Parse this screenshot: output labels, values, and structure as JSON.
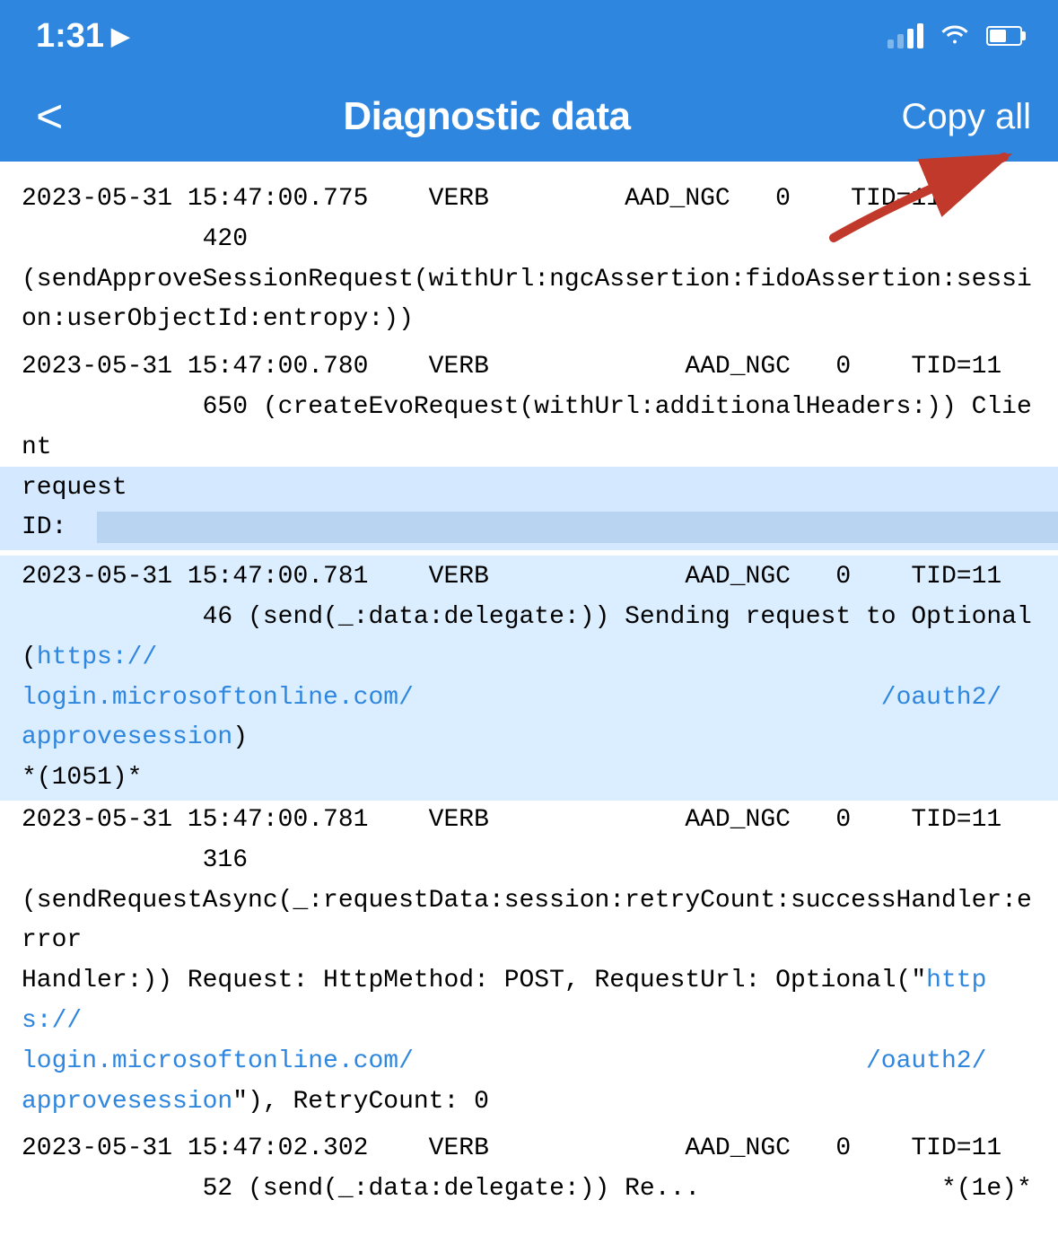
{
  "statusBar": {
    "time": "1:31",
    "timeArrow": "➤"
  },
  "navBar": {
    "backLabel": "<",
    "title": "Diagnostic data",
    "copyAllLabel": "Copy all"
  },
  "logEntries": [
    {
      "id": "entry1",
      "header": "2023-05-31 15:47:00.775    VERB         AAD_NGC    0    TID=11",
      "body": "            420\n(sendApproveSessionRequest(withUrl:ngcAssertion:fidoAssertion:session:userObjectId:entropy:))",
      "hasRequestId": false,
      "hasHighlight": false
    },
    {
      "id": "entry2",
      "header": "2023-05-31 15:47:00.780    VERB              AAD_NGC    0    TID=11",
      "body": "            650 (createEvoRequest(withUrl:additionalHeaders:)) Client\nrequest ID:",
      "hasRequestId": true,
      "hasHighlight": false
    },
    {
      "id": "entry3",
      "header": "2023-05-31 15:47:00.781    VERB              AAD_NGC    0    TID=11",
      "bodyStart": "            46 (send(_:data:delegate:)) Sending request to Optional(",
      "link1": "https://login.microsoftonline.com/",
      "link2": "/oauth2/approvesession",
      "bodyEnd": ")\n*(1051)*",
      "hasHighlight": true
    },
    {
      "id": "entry4",
      "header": "2023-05-31 15:47:00.781    VERB              AAD_NGC    0    TID=11",
      "bodyStart": "            316\n(sendRequestAsync(_:requestData:session:retryCount:successHandler:errorHandler:)) Request: HttpMethod: POST, RequestUrl: Optional(\"",
      "link1": "https://login.microsoftonline.com/",
      "link2": "/oauth2/approvesession",
      "bodyEnd": "\"), RetryCount: 0",
      "hasHighlight": false
    },
    {
      "id": "entry5",
      "header": "2023-05-31 15:47:02.302    VERB              AAD_NGC    0    TID=11",
      "bodyStart": "            52 (send(_:data:delegate:)) Re...",
      "hasHighlight": false,
      "partial": true
    }
  ]
}
